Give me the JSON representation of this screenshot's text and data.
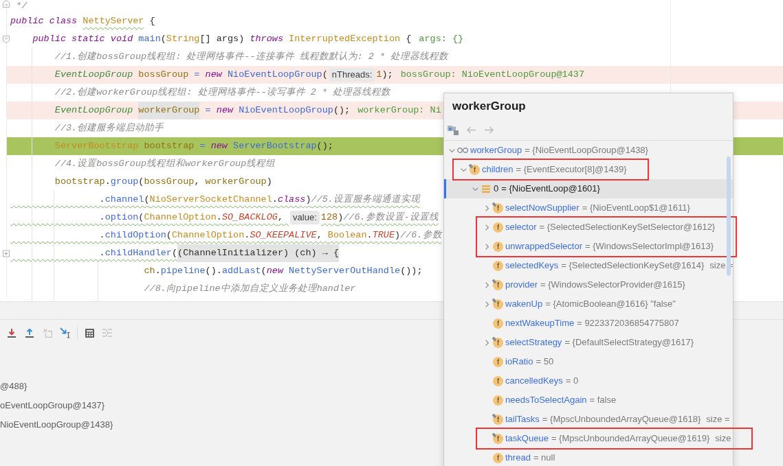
{
  "editor": {
    "lines": [
      {
        "kind": "plain",
        "fold": {
          "kind": "end"
        },
        "parts": [
          {
            "kind": "code",
            "tokens": [
              {
                "text": " */",
                "kind": "comment"
              }
            ]
          }
        ]
      },
      {
        "kind": "plain",
        "parts": [
          {
            "kind": "code",
            "tokens": [
              {
                "text": "public class ",
                "kind": "keyword"
              },
              {
                "text": "NettyServer",
                "kind": "class",
                "wavy": true
              },
              {
                "text": " {",
                "kind": "plain"
              }
            ]
          }
        ]
      },
      {
        "kind": "plain",
        "fold": {
          "kind": "start"
        },
        "parts": [
          {
            "kind": "code",
            "tokens": [
              {
                "text": "    public static void ",
                "kind": "keyword"
              },
              {
                "text": "main",
                "kind": "call"
              },
              {
                "text": "(",
                "kind": "plain"
              },
              {
                "text": "String",
                "kind": "class"
              },
              {
                "text": "[] args) ",
                "kind": "plain"
              },
              {
                "text": "throws",
                "kind": "keyword"
              },
              {
                "text": " InterruptedException",
                "kind": "class"
              },
              {
                "text": " {",
                "kind": "plain"
              }
            ]
          },
          {
            "kind": "debug_value",
            "text": "args: {}"
          }
        ]
      },
      {
        "kind": "plain",
        "parts": [
          {
            "kind": "code",
            "tokens": [
              {
                "text": "        //1.创建bossGroup线程组: 处理网络事件--连接事件 线程数默认为: 2 * 处理器线程数",
                "kind": "comment"
              }
            ]
          }
        ]
      },
      {
        "kind": "breakpoint",
        "parts": [
          {
            "kind": "code",
            "tokens": [
              {
                "text": "        EventLoopGroup",
                "kind": "interface"
              },
              {
                "text": " bossGroup",
                "kind": "local"
              },
              {
                "text": " = ",
                "kind": "op"
              },
              {
                "text": "new",
                "kind": "keyword"
              },
              {
                "text": " NioEventLoopGroup",
                "kind": "call"
              },
              {
                "text": "(",
                "kind": "plain"
              }
            ]
          },
          {
            "kind": "hint",
            "text": "nThreads:"
          },
          {
            "kind": "code",
            "tokens": [
              {
                "text": "1",
                "kind": "number"
              },
              {
                "text": ");",
                "kind": "plain"
              }
            ]
          },
          {
            "kind": "debug_value",
            "text": "bossGroup: NioEventLoopGroup@1437"
          }
        ]
      },
      {
        "kind": "plain",
        "parts": [
          {
            "kind": "code",
            "tokens": [
              {
                "text": "        //2.创建workerGroup线程组: 处理网络事件--读写事件 2 * 处理器线程数",
                "kind": "comment"
              }
            ]
          }
        ]
      },
      {
        "kind": "breakpoint",
        "parts": [
          {
            "kind": "code",
            "tokens": [
              {
                "text": "        EventLoopGroup ",
                "kind": "interface"
              },
              {
                "text": "workerGroup",
                "kind": "local",
                "shaded": true
              },
              {
                "text": " = ",
                "kind": "op"
              },
              {
                "text": "new",
                "kind": "keyword"
              },
              {
                "text": " NioEventLoopGroup",
                "kind": "call"
              },
              {
                "text": "();",
                "kind": "plain"
              }
            ]
          },
          {
            "kind": "debug_value",
            "text": "workerGroup: Ni"
          }
        ]
      },
      {
        "kind": "plain",
        "parts": [
          {
            "kind": "code",
            "tokens": [
              {
                "text": "        //3.创建服务端启动助手",
                "kind": "comment"
              }
            ]
          }
        ]
      },
      {
        "kind": "execution",
        "parts": [
          {
            "kind": "code",
            "tokens": [
              {
                "text": "        ServerBootstrap",
                "kind": "class"
              },
              {
                "text": " bootstrap",
                "kind": "local"
              },
              {
                "text": " = ",
                "kind": "op"
              },
              {
                "text": "new",
                "kind": "keyword"
              },
              {
                "text": " ServerBootstrap",
                "kind": "call"
              },
              {
                "text": "();",
                "kind": "plain"
              }
            ]
          }
        ]
      },
      {
        "kind": "plain",
        "parts": [
          {
            "kind": "code",
            "tokens": [
              {
                "text": "        //4.设置bossGroup线程组和workerGroup线程组",
                "kind": "comment"
              }
            ]
          }
        ]
      },
      {
        "kind": "plain",
        "parts": [
          {
            "kind": "code",
            "tokens": [
              {
                "text": "        bootstrap",
                "kind": "local"
              },
              {
                "text": ".",
                "kind": "plain"
              },
              {
                "text": "group",
                "kind": "call"
              },
              {
                "text": "(",
                "kind": "plain"
              },
              {
                "text": "bossGroup",
                "kind": "local"
              },
              {
                "text": ", ",
                "kind": "plain"
              },
              {
                "text": "workerGroup",
                "kind": "local"
              },
              {
                "text": ")",
                "kind": "plain"
              }
            ]
          }
        ]
      },
      {
        "kind": "plain",
        "parts": [
          {
            "kind": "code",
            "tokens": [
              {
                "text": "                .",
                "kind": "plain",
                "wavy": true
              },
              {
                "text": "channel",
                "kind": "call",
                "wavy": true
              },
              {
                "text": "(",
                "kind": "plain",
                "wavy": true
              },
              {
                "text": "NioServerSocketChannel",
                "kind": "class",
                "wavy": true
              },
              {
                "text": ".",
                "kind": "plain",
                "wavy": true
              },
              {
                "text": "class",
                "kind": "keyword",
                "wavy": true
              },
              {
                "text": ")",
                "kind": "plain",
                "wavy": true
              },
              {
                "text": "//5.设置服务端通道实现",
                "kind": "comment",
                "wavy": true
              }
            ]
          }
        ]
      },
      {
        "kind": "plain",
        "parts": [
          {
            "kind": "code",
            "tokens": [
              {
                "text": "                .",
                "kind": "plain",
                "wavy": true
              },
              {
                "text": "option",
                "kind": "call",
                "wavy": true
              },
              {
                "text": "(",
                "kind": "plain",
                "wavy": true
              },
              {
                "text": "ChannelOption",
                "kind": "class",
                "wavy": true
              },
              {
                "text": ".",
                "kind": "plain",
                "wavy": true
              },
              {
                "text": "SO_BACKLOG",
                "kind": "constant",
                "wavy": true
              },
              {
                "text": ", ",
                "kind": "plain",
                "wavy": true
              }
            ]
          },
          {
            "kind": "hint",
            "text": "value:"
          },
          {
            "kind": "code",
            "tokens": [
              {
                "text": "128",
                "kind": "number",
                "wavy": true
              },
              {
                "text": ")",
                "kind": "plain",
                "wavy": true
              },
              {
                "text": "//6.参数设置-设置线",
                "kind": "comment",
                "wavy": true
              }
            ]
          }
        ]
      },
      {
        "kind": "plain",
        "parts": [
          {
            "kind": "code",
            "tokens": [
              {
                "text": "                .",
                "kind": "plain",
                "wavy": true
              },
              {
                "text": "childOption",
                "kind": "call",
                "wavy": true
              },
              {
                "text": "(",
                "kind": "plain",
                "wavy": true
              },
              {
                "text": "ChannelOption",
                "kind": "class",
                "wavy": true
              },
              {
                "text": ".",
                "kind": "plain",
                "wavy": true
              },
              {
                "text": "SO_KEEPALIVE",
                "kind": "constant",
                "wavy": true
              },
              {
                "text": ", ",
                "kind": "plain",
                "wavy": true
              },
              {
                "text": "Boolean",
                "kind": "class",
                "wavy": true
              },
              {
                "text": ".",
                "kind": "plain",
                "wavy": true
              },
              {
                "text": "TRUE",
                "kind": "constant",
                "wavy": true
              },
              {
                "text": ")",
                "kind": "plain",
                "wavy": true
              },
              {
                "text": "//6.参数",
                "kind": "comment",
                "wavy": true
              }
            ]
          }
        ]
      },
      {
        "kind": "plain",
        "fold": {
          "kind": "collapsed"
        },
        "parts": [
          {
            "kind": "code",
            "tokens": [
              {
                "text": "                .",
                "kind": "plain",
                "wavy": true
              },
              {
                "text": "childHandler",
                "kind": "call",
                "wavy": true
              },
              {
                "text": "(",
                "kind": "plain",
                "wavy": true
              },
              {
                "text": "(ChannelInitializer) (ch) → {",
                "kind": "plain",
                "shaded": true
              }
            ]
          }
        ]
      },
      {
        "kind": "plain",
        "parts": [
          {
            "kind": "code",
            "tokens": [
              {
                "text": "                        ch",
                "kind": "local"
              },
              {
                "text": ".",
                "kind": "plain"
              },
              {
                "text": "pipeline",
                "kind": "call"
              },
              {
                "text": "().",
                "kind": "plain"
              },
              {
                "text": "addLast",
                "kind": "call"
              },
              {
                "text": "(",
                "kind": "plain"
              },
              {
                "text": "new",
                "kind": "keyword"
              },
              {
                "text": " NettyServerOutHandle",
                "kind": "call"
              },
              {
                "text": "());",
                "kind": "plain"
              }
            ]
          }
        ]
      },
      {
        "kind": "plain",
        "parts": [
          {
            "kind": "code",
            "tokens": [
              {
                "text": "                        //8.向pipeline中添加自定义业务处理handler",
                "kind": "comment"
              }
            ]
          }
        ]
      }
    ]
  },
  "debugger": {
    "toolbar": [
      {
        "kind": "force_step_into",
        "disabled": false
      },
      {
        "kind": "step_out",
        "disabled": false
      },
      {
        "kind": "drop_frame",
        "disabled": true
      },
      {
        "kind": "run_to_cursor",
        "disabled": false
      },
      {
        "kind": "separator"
      },
      {
        "kind": "evaluate",
        "disabled": false
      },
      {
        "kind": "trace_stream",
        "disabled": true
      }
    ],
    "variables": [
      "@488}",
      "oEventLoopGroup@1437}",
      "NioEventLoopGroup@1438}"
    ]
  },
  "popup": {
    "title": "workerGroup",
    "toolbar": [
      {
        "kind": "view",
        "disabled": false
      },
      {
        "kind": "back",
        "disabled": true
      },
      {
        "kind": "forward",
        "disabled": true
      }
    ],
    "tree": [
      {
        "kind": "watch",
        "name": "workerGroup",
        "value": "= {NioEventLoopGroup@1438}",
        "expanded": true,
        "selected": false,
        "children": [
          {
            "kind": "field",
            "icon_text": "f",
            "final": true,
            "framed": true,
            "name": "children",
            "value": "= {EventExecutor[8]@1439}",
            "expanded": true,
            "selected": false,
            "children": [
              {
                "kind": "array_element",
                "name": "0",
                "value": "= {NioEventLoop@1601}",
                "expanded": true,
                "selected": true,
                "children": [
                  {
                    "kind": "field",
                    "icon_text": "f",
                    "final": true,
                    "name": "selectNowSupplier",
                    "value": "= {NioEventLoop$1@1611}",
                    "expanded": false,
                    "selected": false
                  },
                  {
                    "kind": "field",
                    "icon_text": "f",
                    "final": false,
                    "framed": true,
                    "name": "selector",
                    "value": "= {SelectedSelectionKeySetSelector@1612}",
                    "expanded": false,
                    "selected": false
                  },
                  {
                    "kind": "field",
                    "icon_text": "f",
                    "final": false,
                    "framed": true,
                    "name": "unwrappedSelector",
                    "value": "= {WindowsSelectorImpl@1613}",
                    "expanded": false,
                    "selected": false
                  },
                  {
                    "kind": "field",
                    "icon_text": "f",
                    "final": false,
                    "name": "selectedKeys",
                    "value": "= {SelectedSelectionKeySet@1614}",
                    "extra": "size =",
                    "selected": false
                  },
                  {
                    "kind": "field",
                    "icon_text": "f",
                    "final": true,
                    "name": "provider",
                    "value": "= {WindowsSelectorProvider@1615}",
                    "expanded": false,
                    "selected": false
                  },
                  {
                    "kind": "field",
                    "icon_text": "f",
                    "final": true,
                    "name": "wakenUp",
                    "value": "= {AtomicBoolean@1616} \"false\"",
                    "expanded": false,
                    "selected": false
                  },
                  {
                    "kind": "field",
                    "icon_text": "f",
                    "final": false,
                    "name": "nextWakeupTime",
                    "value": "= 9223372036854775807",
                    "selected": false
                  },
                  {
                    "kind": "field",
                    "icon_text": "f",
                    "final": true,
                    "name": "selectStrategy",
                    "value": "= {DefaultSelectStrategy@1617}",
                    "expanded": false,
                    "selected": false
                  },
                  {
                    "kind": "field",
                    "icon_text": "f",
                    "final": false,
                    "name": "ioRatio",
                    "value": "= 50",
                    "selected": false
                  },
                  {
                    "kind": "field",
                    "icon_text": "f",
                    "final": false,
                    "name": "cancelledKeys",
                    "value": "= 0",
                    "selected": false
                  },
                  {
                    "kind": "field",
                    "icon_text": "f",
                    "final": false,
                    "name": "needsToSelectAgain",
                    "value": "= false",
                    "selected": false
                  },
                  {
                    "kind": "field",
                    "icon_text": "f",
                    "final": true,
                    "name": "tailTasks",
                    "value": "= {MpscUnboundedArrayQueue@1618}",
                    "extra": "size =",
                    "selected": false
                  },
                  {
                    "kind": "field",
                    "icon_text": "f",
                    "final": true,
                    "framed": true,
                    "name": "taskQueue",
                    "value": "= {MpscUnboundedArrayQueue@1619}",
                    "extra": "size",
                    "selected": false
                  },
                  {
                    "kind": "field",
                    "icon_text": "f",
                    "final": false,
                    "name": "thread",
                    "value": "= null",
                    "selected": false
                  }
                ]
              }
            ]
          }
        ]
      }
    ]
  }
}
